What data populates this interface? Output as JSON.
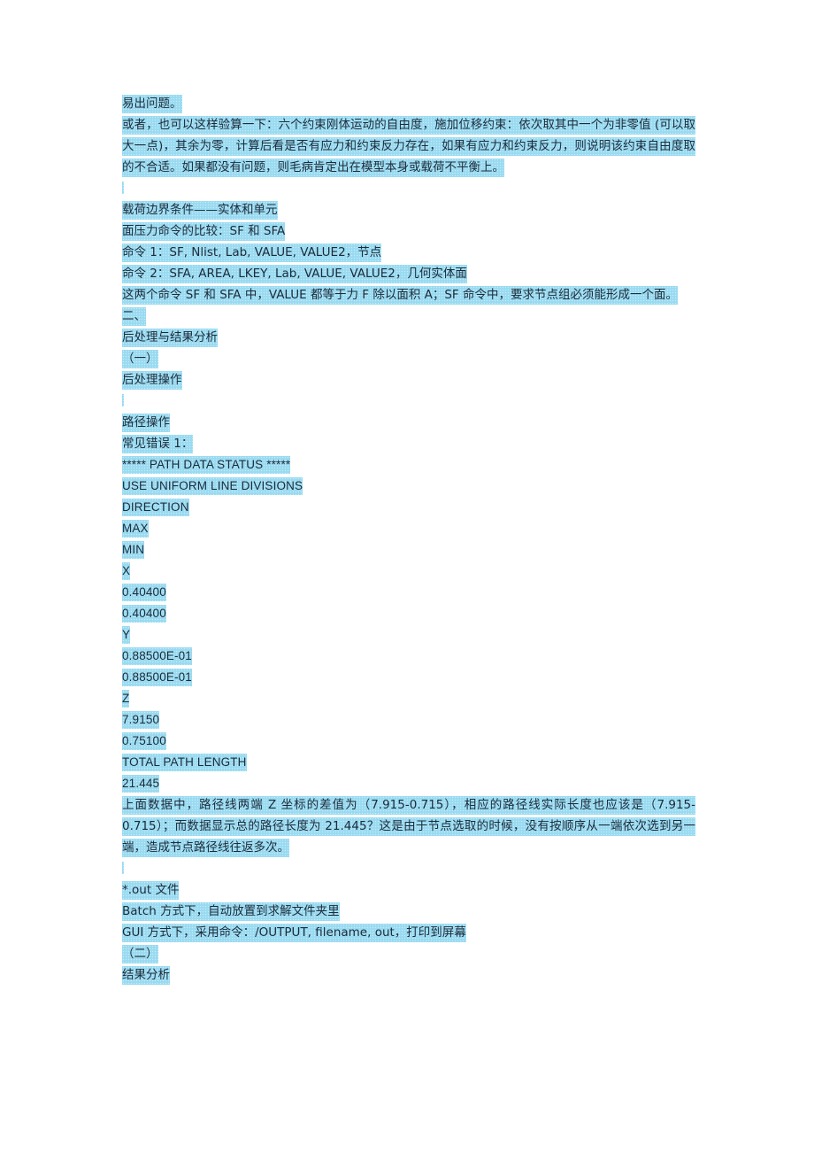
{
  "document": {
    "highlight_color": "#9edcf2",
    "text_color": "#1b2b3a",
    "page_background": "#ffffff",
    "lines": [
      {
        "id": "l1",
        "type": "text",
        "text": "易出问题。"
      },
      {
        "id": "l2",
        "type": "text",
        "text": "或者，也可以这样验算一下：六个约束刚体运动的自由度，施加位移约束：依次取其中一个为非零值 (可以取大一点)，其余为零，计算后看是否有应力和约束反力存在，如果有应力和约束反力，则说明该约束自由度取的不合适。如果都没有问题，则毛病肯定出在模型本身或载荷不平衡上。"
      },
      {
        "id": "l3",
        "type": "caret",
        "text": ""
      },
      {
        "id": "l4",
        "type": "text",
        "text": "载荷边界条件——实体和单元"
      },
      {
        "id": "l5",
        "type": "text",
        "text": "面压力命令的比较：SF 和 SFA"
      },
      {
        "id": "l6",
        "type": "text",
        "text": "命令 1：SF, Nlist, Lab, VALUE, VALUE2，节点"
      },
      {
        "id": "l7",
        "type": "text",
        "text": "命令 2：SFA, AREA, LKEY, Lab, VALUE, VALUE2，几何实体面"
      },
      {
        "id": "l8",
        "type": "text",
        "text": "这两个命令 SF 和 SFA 中，VALUE 都等于力 F 除以面积 A；SF 命令中，要求节点组必须能形成一个面。"
      },
      {
        "id": "l9",
        "type": "text",
        "text": "二、"
      },
      {
        "id": "l10",
        "type": "text",
        "text": "后处理与结果分析"
      },
      {
        "id": "l11",
        "type": "text",
        "text": "（一）"
      },
      {
        "id": "l12",
        "type": "text",
        "text": "后处理操作"
      },
      {
        "id": "l13",
        "type": "caret",
        "text": ""
      },
      {
        "id": "l14",
        "type": "text",
        "text": "路径操作"
      },
      {
        "id": "l15",
        "type": "text",
        "text": "常见错误 1："
      },
      {
        "id": "l16",
        "type": "mono",
        "text": "***** PATH DATA STATUS *****"
      },
      {
        "id": "l17",
        "type": "mono",
        "text": "USE UNIFORM LINE DIVISIONS"
      },
      {
        "id": "l18",
        "type": "mono",
        "text": "DIRECTION"
      },
      {
        "id": "l19",
        "type": "mono",
        "text": "MAX"
      },
      {
        "id": "l20",
        "type": "mono",
        "text": "MIN"
      },
      {
        "id": "l21",
        "type": "mono",
        "text": "X"
      },
      {
        "id": "l22",
        "type": "mono",
        "text": "0.40400"
      },
      {
        "id": "l23",
        "type": "mono",
        "text": "0.40400"
      },
      {
        "id": "l24",
        "type": "mono",
        "text": "Y"
      },
      {
        "id": "l25",
        "type": "mono",
        "text": "0.88500E-01"
      },
      {
        "id": "l26",
        "type": "mono",
        "text": "0.88500E-01"
      },
      {
        "id": "l27",
        "type": "mono",
        "text": "Z"
      },
      {
        "id": "l28",
        "type": "mono",
        "text": "7.9150"
      },
      {
        "id": "l29",
        "type": "mono",
        "text": "0.75100"
      },
      {
        "id": "l30",
        "type": "mono",
        "text": "TOTAL PATH LENGTH"
      },
      {
        "id": "l31",
        "type": "mono",
        "text": "21.445"
      },
      {
        "id": "l32",
        "type": "text",
        "text": "上面数据中，路径线两端 Z 坐标的差值为（7.915-0.715），相应的路径线实际长度也应该是（7.915-0.715）；而数据显示总的路径长度为 21.445？这是由于节点选取的时候，没有按顺序从一端依次选到另一端，造成节点路径线往返多次。"
      },
      {
        "id": "l33",
        "type": "caret",
        "text": ""
      },
      {
        "id": "l34",
        "type": "text",
        "text": "*.out 文件"
      },
      {
        "id": "l35",
        "type": "text",
        "text": "Batch 方式下，自动放置到求解文件夹里"
      },
      {
        "id": "l36",
        "type": "text",
        "text": "GUI 方式下，采用命令：/OUTPUT, filename, out，打印到屏幕"
      },
      {
        "id": "l37",
        "type": "text",
        "text": "（二）"
      },
      {
        "id": "l38",
        "type": "text",
        "text": "结果分析"
      }
    ]
  }
}
